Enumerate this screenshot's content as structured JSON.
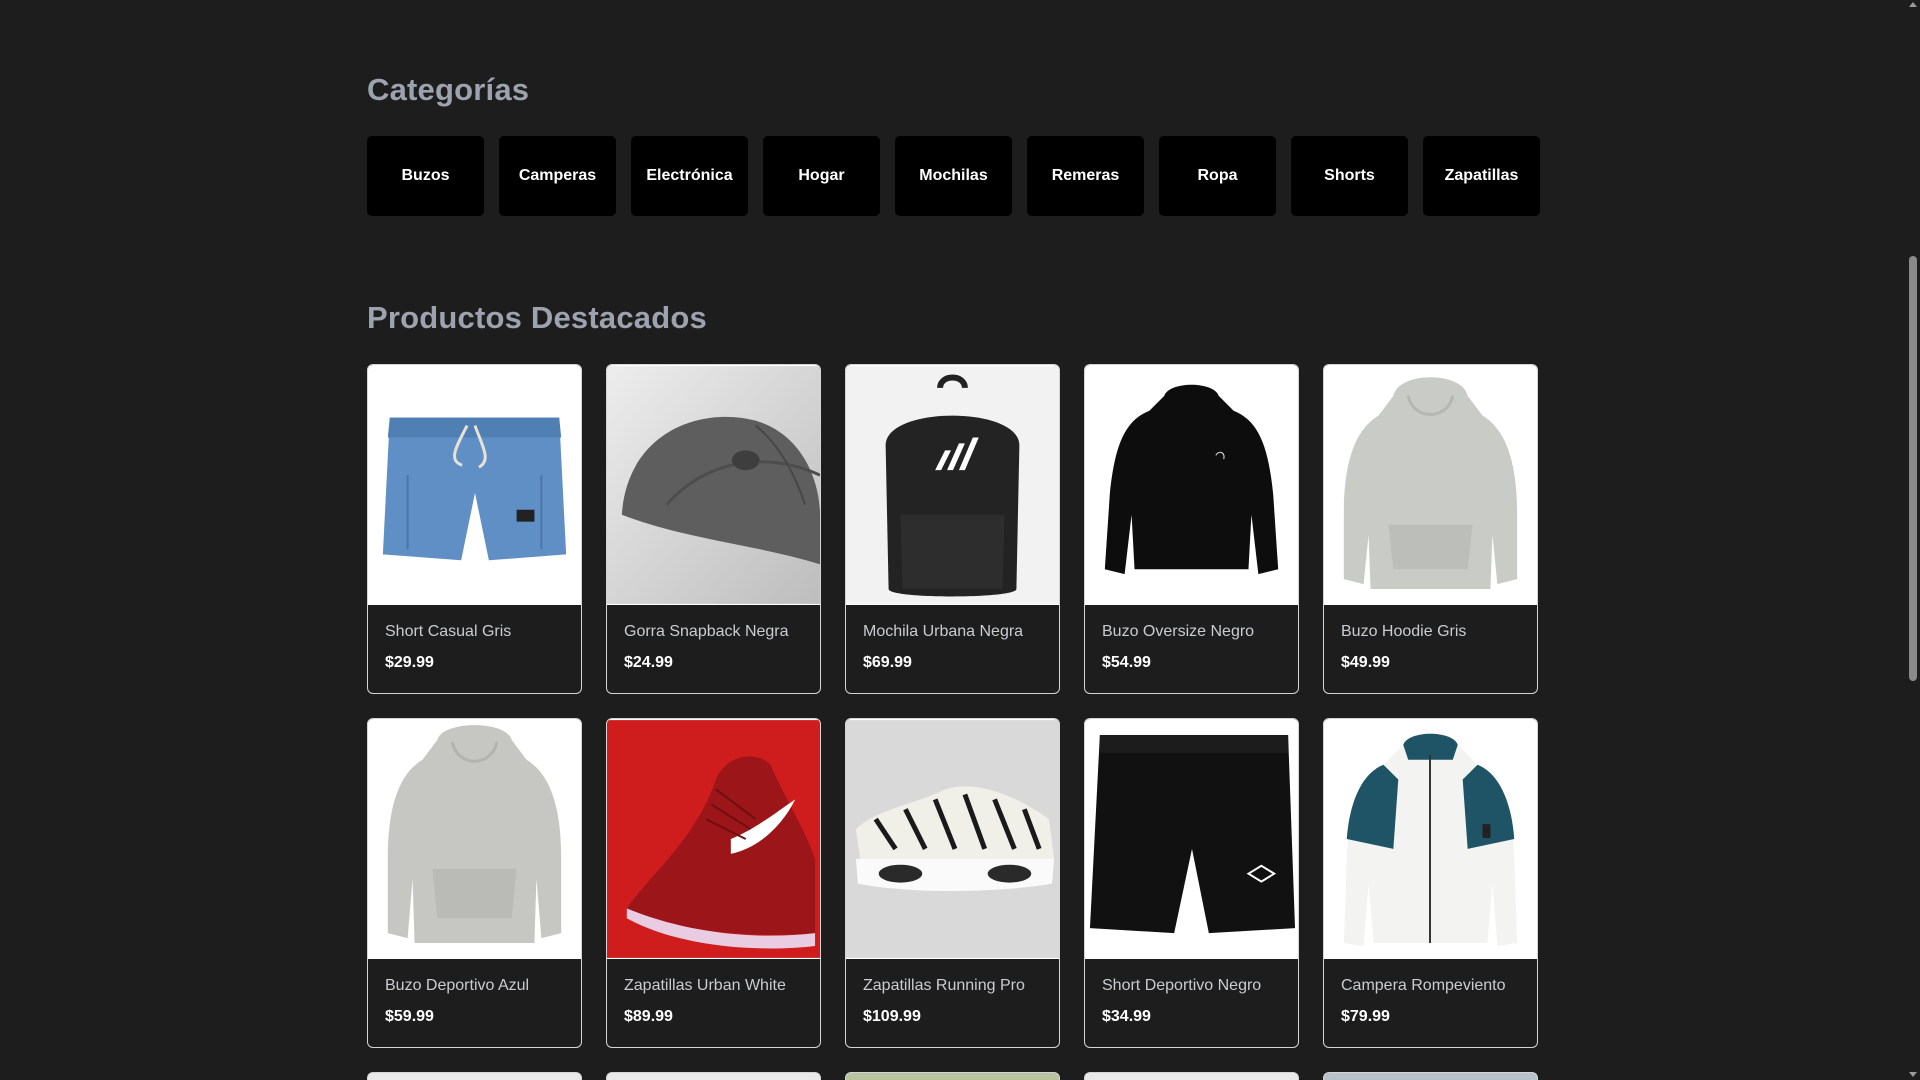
{
  "categories_section": {
    "title": "Categorías",
    "items": [
      "Buzos",
      "Camperas",
      "Electrónica",
      "Hogar",
      "Mochilas",
      "Remeras",
      "Ropa",
      "Shorts",
      "Zapatillas"
    ]
  },
  "featured_section": {
    "title": "Productos Destacados",
    "products": [
      {
        "name": "Short Casual Gris",
        "price": "$29.99",
        "icon": "denim-shorts-image"
      },
      {
        "name": "Gorra Snapback Negra",
        "price": "$24.99",
        "icon": "cap-image"
      },
      {
        "name": "Mochila Urbana Negra",
        "price": "$69.99",
        "icon": "backpack-image"
      },
      {
        "name": "Buzo Oversize Negro",
        "price": "$54.99",
        "icon": "black-hoodie-image"
      },
      {
        "name": "Buzo Hoodie Gris",
        "price": "$49.99",
        "icon": "grey-hoodie-image"
      },
      {
        "name": "Buzo Deportivo Azul",
        "price": "$59.99",
        "icon": "grey-hoodie-image"
      },
      {
        "name": "Zapatillas Urban White",
        "price": "$89.99",
        "icon": "red-sneaker-image"
      },
      {
        "name": "Zapatillas Running Pro",
        "price": "$109.99",
        "icon": "white-sneaker-image"
      },
      {
        "name": "Short Deportivo Negro",
        "price": "$34.99",
        "icon": "black-shorts-image"
      },
      {
        "name": "Campera Rompeviento",
        "price": "$79.99",
        "icon": "windbreaker-jacket-image"
      }
    ]
  },
  "colors": {
    "background": "#1d1d1d",
    "category_button": "#000000",
    "section_title": "#9ca3af",
    "card_border": "#d4d4d4"
  }
}
